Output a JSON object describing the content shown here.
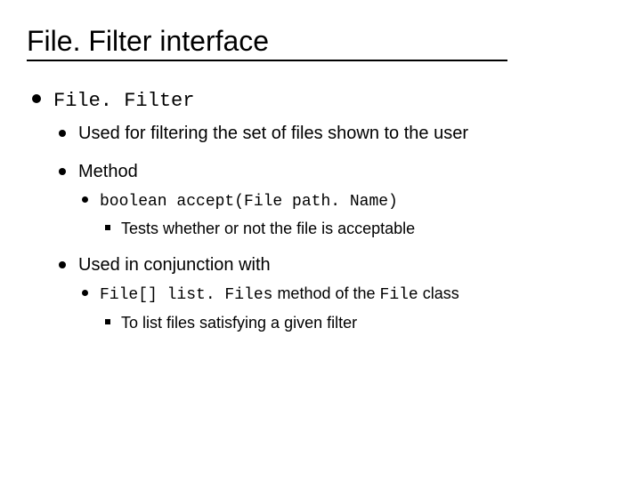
{
  "title": "File. Filter interface",
  "lvl1": {
    "text": "File. Filter",
    "lvl2": [
      {
        "text": "Used for filtering the set of files shown to the user"
      },
      {
        "text": "Method",
        "lvl3": [
          {
            "code": "boolean accept(File path. Name)",
            "lvl4": [
              {
                "text": "Tests whether or not the file is acceptable"
              }
            ]
          }
        ]
      },
      {
        "text": "Used in conjunction with",
        "lvl3": [
          {
            "code": "File[] list. Files",
            "trail": " method of the ",
            "code2": "File",
            "trail2": " class",
            "lvl4": [
              {
                "text": "To list files satisfying a given filter"
              }
            ]
          }
        ]
      }
    ]
  }
}
